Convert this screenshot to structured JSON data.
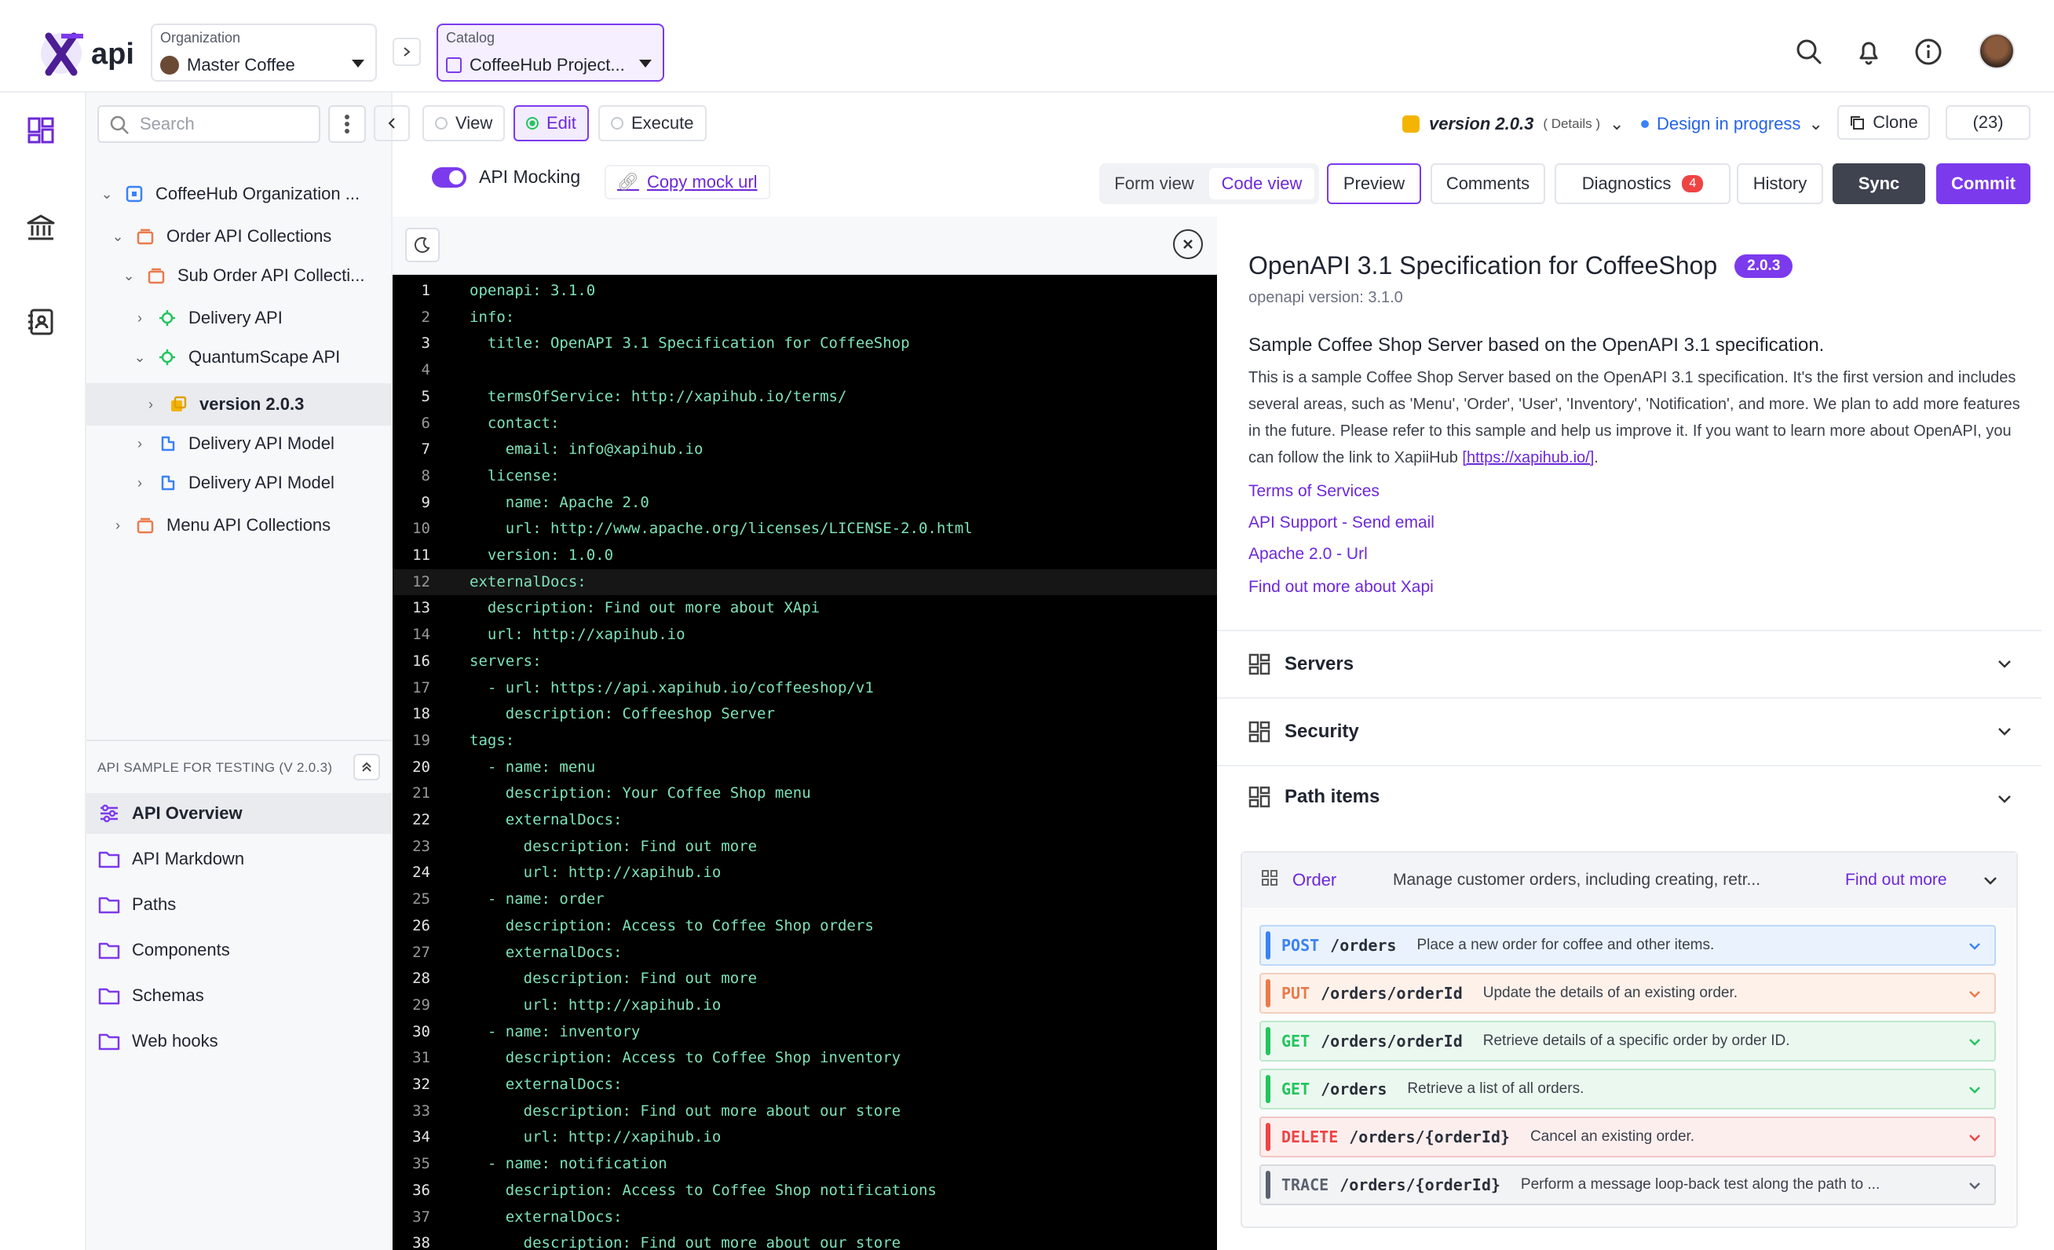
{
  "header": {
    "logo_text": "api",
    "organization": {
      "caption": "Organization",
      "value": "Master Coffee"
    },
    "catalog": {
      "caption": "Catalog",
      "value": "CoffeeHub Project..."
    }
  },
  "toolbar": {
    "search_placeholder": "Search",
    "view_label": "View",
    "edit_label": "Edit",
    "execute_label": "Execute",
    "version_label": "version 2.0.3",
    "details_label": "( Details )",
    "status_label": "Design in progress",
    "clone_label": "Clone",
    "count_label": "(23)"
  },
  "tree": {
    "items": [
      {
        "label": "CoffeeHub Organization ..."
      },
      {
        "label": "Order API Collections"
      },
      {
        "label": "Sub Order API Collecti..."
      },
      {
        "label": "Delivery API"
      },
      {
        "label": "QuantumScape API"
      },
      {
        "label": "version 2.0.3"
      },
      {
        "label": "Delivery API Model"
      },
      {
        "label": "Delivery API Model"
      },
      {
        "label": "Menu API Collections"
      }
    ],
    "section_title": "API SAMPLE FOR TESTING (V 2.0.3)",
    "nav": [
      {
        "label": "API Overview"
      },
      {
        "label": "API Markdown"
      },
      {
        "label": "Paths"
      },
      {
        "label": "Components"
      },
      {
        "label": "Schemas"
      },
      {
        "label": "Web hooks"
      }
    ]
  },
  "editor_bar": {
    "mocking_label": "API Mocking",
    "copy_mock_label": "Copy mock url",
    "form_view": "Form view",
    "code_view": "Code view",
    "preview": "Preview",
    "comments": "Comments",
    "diagnostics": "Diagnostics",
    "diagnostics_count": "4",
    "history": "History",
    "sync": "Sync",
    "commit": "Commit"
  },
  "code": [
    {
      "n": "1",
      "t": "openapi: 3.1.0"
    },
    {
      "n": "2",
      "t": "info:"
    },
    {
      "n": "3",
      "t": "  title: OpenAPI 3.1 Specification for CoffeeShop"
    },
    {
      "n": "4",
      "t": ""
    },
    {
      "n": "5",
      "t": "  termsOfService: http://xapihub.io/terms/"
    },
    {
      "n": "6",
      "t": "  contact:"
    },
    {
      "n": "7",
      "t": "    email: info@xapihub.io"
    },
    {
      "n": "8",
      "t": "  license:"
    },
    {
      "n": "9",
      "t": "    name: Apache 2.0"
    },
    {
      "n": "10",
      "t": "    url: http://www.apache.org/licenses/LICENSE-2.0.html"
    },
    {
      "n": "11",
      "t": "  version: 1.0.0"
    },
    {
      "n": "12",
      "t": "externalDocs:"
    },
    {
      "n": "13",
      "t": "  description: Find out more about XApi"
    },
    {
      "n": "14",
      "t": "  url: http://xapihub.io"
    },
    {
      "n": "16",
      "t": "servers:"
    },
    {
      "n": "17",
      "t": "  - url: https://api.xapihub.io/coffeeshop/v1"
    },
    {
      "n": "18",
      "t": "    description: Coffeeshop Server"
    },
    {
      "n": "19",
      "t": "tags:"
    },
    {
      "n": "20",
      "t": "  - name: menu"
    },
    {
      "n": "21",
      "t": "    description: Your Coffee Shop menu"
    },
    {
      "n": "22",
      "t": "    externalDocs:"
    },
    {
      "n": "23",
      "t": "      description: Find out more"
    },
    {
      "n": "24",
      "t": "      url: http://xapihub.io"
    },
    {
      "n": "25",
      "t": "  - name: order"
    },
    {
      "n": "26",
      "t": "    description: Access to Coffee Shop orders"
    },
    {
      "n": "27",
      "t": "    externalDocs:"
    },
    {
      "n": "28",
      "t": "      description: Find out more"
    },
    {
      "n": "29",
      "t": "      url: http://xapihub.io"
    },
    {
      "n": "30",
      "t": "  - name: inventory"
    },
    {
      "n": "31",
      "t": "    description: Access to Coffee Shop inventory"
    },
    {
      "n": "32",
      "t": "    externalDocs:"
    },
    {
      "n": "33",
      "t": "      description: Find out more about our store"
    },
    {
      "n": "34",
      "t": "      url: http://xapihub.io"
    },
    {
      "n": "35",
      "t": "  - name: notification"
    },
    {
      "n": "36",
      "t": "    description: Access to Coffee Shop notifications"
    },
    {
      "n": "37",
      "t": "    externalDocs:"
    },
    {
      "n": "38",
      "t": "      description: Find out more about our store"
    }
  ],
  "preview": {
    "title": "OpenAPI 3.1 Specification for CoffeeShop",
    "version_badge": "2.0.3",
    "openapi_version": "openapi version: 3.1.0",
    "subtitle": "Sample Coffee Shop Server based on the OpenAPI 3.1 specification.",
    "description": "This is a sample Coffee Shop Server based on the OpenAPI 3.1 specification. It's the first version and includes several areas, such as 'Menu', 'Order', 'User', 'Inventory', 'Notification', and more. We plan to add more features in the future. Please refer to this sample and help us improve it. If you want to learn more about OpenAPI, you can follow the link to XapiiHub",
    "description_link": "[https://xapihub.io/]",
    "links": [
      "Terms of Services",
      "API Support - Send email",
      "Apache 2.0 - Url",
      "Find out more about Xapi"
    ],
    "sections": [
      "Servers",
      "Security",
      "Path items"
    ],
    "order_group": {
      "name": "Order",
      "description": "Manage customer orders, including creating, retr...",
      "find_out_more": "Find out more"
    },
    "operations": [
      {
        "method": "POST",
        "path": "/orders",
        "desc": "Place a new order for coffee and other items."
      },
      {
        "method": "PUT",
        "path": "/orders/orderId",
        "desc": "Update the details of an existing order."
      },
      {
        "method": "GET",
        "path": "/orders/orderId",
        "desc": "Retrieve details of a specific order by order ID."
      },
      {
        "method": "GET",
        "path": "/orders",
        "desc": "Retrieve a list of all orders."
      },
      {
        "method": "DELETE",
        "path": "/orders/{orderId}",
        "desc": "Cancel an existing order."
      },
      {
        "method": "TRACE",
        "path": "/orders/{orderId}",
        "desc": "Perform a message loop-back test along the path to ..."
      }
    ]
  },
  "colors": {
    "accent": "#7c3aed",
    "post": "#3b82f6",
    "put": "#ea7a4a",
    "get": "#22c55e",
    "delete": "#ef4444",
    "trace": "#5b6270"
  }
}
